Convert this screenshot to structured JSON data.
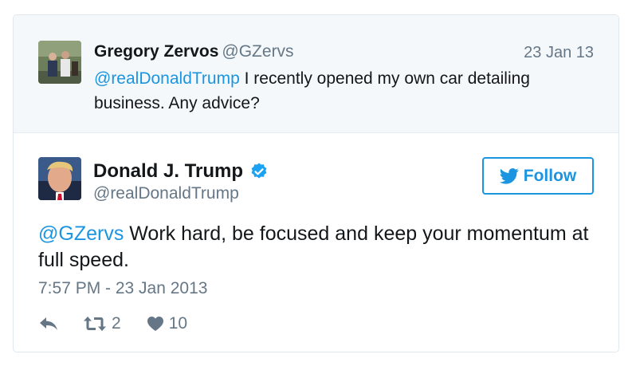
{
  "parent_tweet": {
    "author_name": "Gregory Zervos",
    "author_handle": "@GZervs",
    "date": "23 Jan 13",
    "mention": "@realDonaldTrump",
    "text": " I recently opened my own car detailing business. Any advice?"
  },
  "tweet": {
    "author_name": "Donald J. Trump",
    "author_handle": "@realDonaldTrump",
    "verified_icon": "verified-badge-icon",
    "follow_label": "Follow",
    "mention": "@GZervs",
    "text": " Work hard, be focused and keep your momentum at full speed.",
    "timestamp": "7:57 PM - 23 Jan 2013",
    "retweet_count": "2",
    "like_count": "10"
  },
  "colors": {
    "accent": "#1b95e0",
    "muted": "#657786",
    "text": "#14171a",
    "parent_bg": "#f5f8fa",
    "border": "#e1e8ed"
  },
  "icons": [
    "bird-icon",
    "reply-icon",
    "retweet-icon",
    "heart-icon",
    "verified-badge-icon"
  ]
}
